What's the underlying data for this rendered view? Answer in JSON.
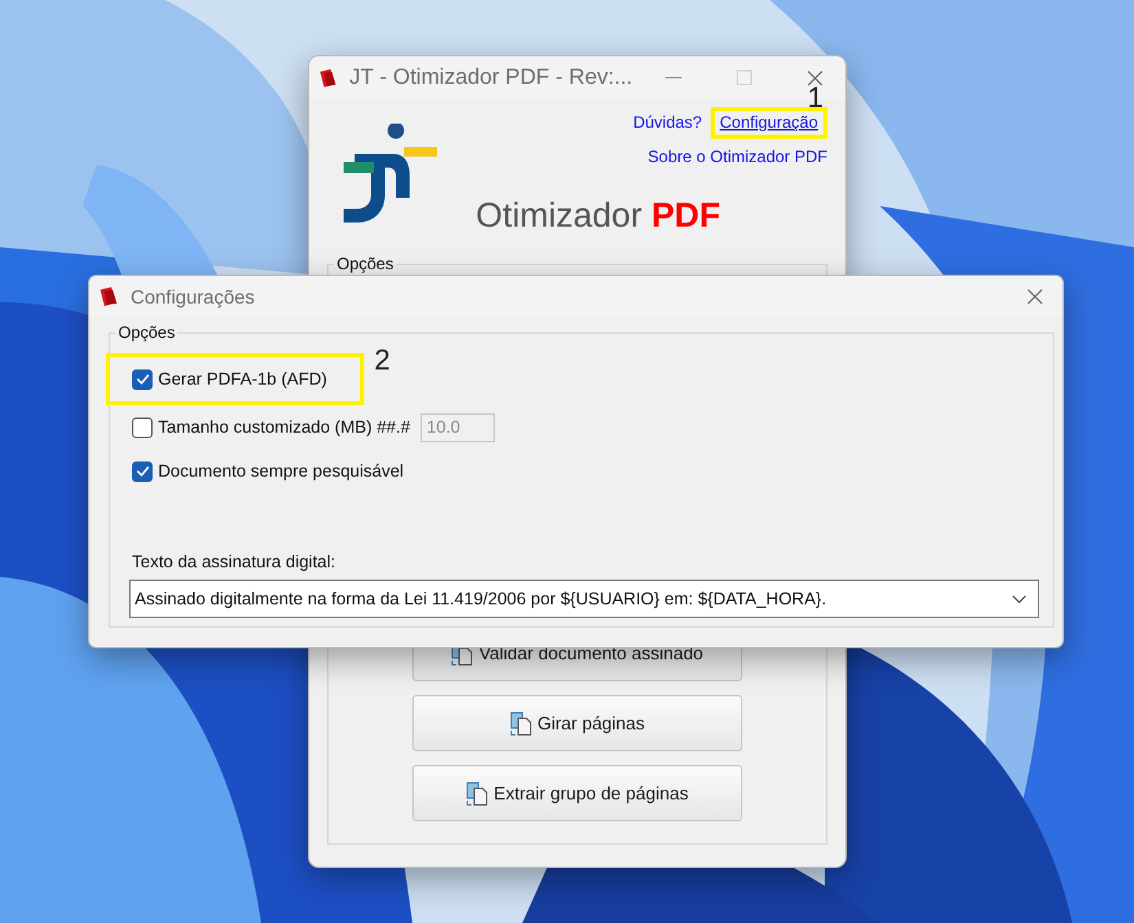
{
  "main_window": {
    "title": "JT - Otimizador PDF - Rev:...",
    "links": [
      {
        "label": "Dúvidas?",
        "underlined": false
      },
      {
        "label": "Configuração",
        "underlined": true,
        "highlight": "1"
      },
      {
        "label": "Sobre o Otimizador PDF",
        "underlined": false
      }
    ],
    "app_name": "Otimizador",
    "app_name_accent": "PDF",
    "group_label": "Opções",
    "buttons": [
      "Validar documento assinado",
      "Girar páginas",
      "Extrair grupo de páginas"
    ]
  },
  "dialog": {
    "title": "Configurações",
    "group_label": "Opções",
    "options": [
      {
        "kind": "checkbox",
        "label": "Gerar PDFA-1b (AFD)",
        "checked": true,
        "highlight": "2"
      },
      {
        "kind": "checkbox_field",
        "label": "Tamanho customizado (MB) ##.#",
        "checked": false,
        "field_value": "10.0",
        "field_disabled": true
      },
      {
        "kind": "checkbox",
        "label": "Documento sempre pesquisável",
        "checked": true
      }
    ],
    "signature_label": "Texto da assinatura digital:",
    "signature_value": "Assinado digitalmente na forma da Lei 11.419/2006 por ${USUARIO} em: ${DATA_HORA}."
  }
}
